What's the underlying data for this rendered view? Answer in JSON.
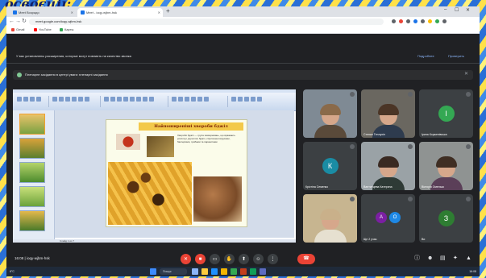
{
  "heading": "освоєції:",
  "browser": {
    "tabs": [
      {
        "label": "Meet Возрадо",
        "active": false
      },
      {
        "label": "Meet - ioqy-wjbm-hsk",
        "active": true
      }
    ],
    "url": "meet.google.com/ioqy-wjbm-hsk",
    "bookmarks": [
      "Gmail",
      "YouTube",
      "Карты"
    ],
    "new_tab": "+",
    "window_controls": [
      "–",
      "☐",
      "✕"
    ]
  },
  "warning": {
    "text": "У вас установлены расширения, которые могут повлиять на качество звонка",
    "actions": [
      "Подробнее",
      "Проверить"
    ]
  },
  "notice": {
    "text": "Пленарне засідання в центрі уваги: пленарні засідання",
    "close": "✕"
  },
  "slide": {
    "title": "Найпоширеніші хвороби бджіл",
    "body": "Хвороби бджіл — група захворювань, що вражають розплід і дорослих бджіл, спричинені вірусами, бактеріями, грибами та паразитами",
    "slide_count": 7,
    "status_left": "Слайд 1 из 7"
  },
  "participants": [
    {
      "name": "",
      "type": "video",
      "hair": "#8a6a4a",
      "torso": "#5a4a3a",
      "bg": "#7f8a94"
    },
    {
      "name": "Степан Теплухін",
      "type": "video",
      "hair": "#4b3526",
      "torso": "#2e3b4e",
      "bg": "#6a6760"
    },
    {
      "name": "Ірина Корженівська",
      "type": "avatar",
      "initial": "І",
      "color": "#34a853"
    },
    {
      "name": "Крістіна Семенко",
      "type": "avatar",
      "initial": "К",
      "color": "#1a8ca4"
    },
    {
      "name": "Вантинцева Катерина",
      "type": "video",
      "hair": "#3a2a22",
      "torso": "#2e3a36",
      "bg": "#9aa2a6"
    },
    {
      "name": "Вікторія Омелько",
      "type": "video",
      "hair": "#3f2e23",
      "torso": "#5b3f58",
      "bg": "#8f9392"
    },
    {
      "name": "",
      "type": "video",
      "hair": "#c9b08a",
      "torso": "#e6e0d0",
      "bg": "#c7b590"
    },
    {
      "name": "Ще 2 учас.",
      "type": "group",
      "initials": [
        "А",
        "О"
      ],
      "colors": [
        "#7b1fa2",
        "#1e88e5"
      ]
    },
    {
      "name": "Ви",
      "type": "avatar",
      "initial": "З",
      "color": "#2e7d32"
    }
  ],
  "meeting": {
    "time": "16:08",
    "code": "ioqy-wjbm-hsk",
    "separator": "|"
  },
  "controls": [
    "mic-off",
    "camera-off",
    "captions",
    "raise-hand",
    "present",
    "reactions",
    "more"
  ],
  "taskbar": {
    "weather": "6°C",
    "search": "Пошук",
    "clock": "16:08"
  },
  "colors": {
    "meet_bg": "#202124",
    "red": "#ea4335",
    "accent": "#8ab4f8"
  }
}
